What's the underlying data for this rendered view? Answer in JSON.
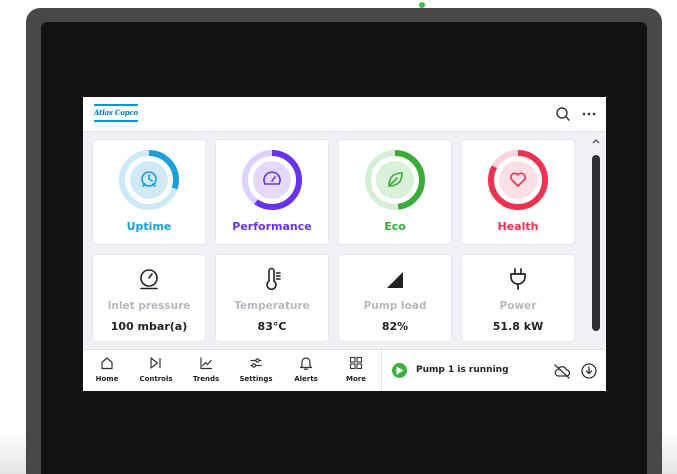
{
  "brand": {
    "logo_text": "Atlas Copco"
  },
  "colors": {
    "uptime": "#1a9fd8",
    "performance": "#6633ee",
    "eco": "#3aac3a",
    "health": "#ee3352",
    "status_running": "#3bb33b"
  },
  "header": {
    "search_icon": "search-icon",
    "more_icon": "more-horizontal-icon"
  },
  "rings": [
    {
      "label": "Uptime",
      "icon": "clock-icon",
      "fill": 0.3
    },
    {
      "label": "Performance",
      "icon": "gauge-icon",
      "fill": 0.6
    },
    {
      "label": "Eco",
      "icon": "leaf-icon",
      "fill": 0.48
    },
    {
      "label": "Health",
      "icon": "heart-icon",
      "fill": 0.83
    }
  ],
  "metrics": [
    {
      "label": "Inlet pressure",
      "value": "100 mbar(a)",
      "icon": "pressure-gauge-icon"
    },
    {
      "label": "Temperature",
      "value": "83°C",
      "icon": "thermometer-icon"
    },
    {
      "label": "Pump load",
      "value": "82%",
      "icon": "signal-ramp-icon"
    },
    {
      "label": "Power",
      "value": "51.8 kW",
      "icon": "plug-icon"
    }
  ],
  "nav": [
    {
      "label": "Home",
      "icon": "home-icon"
    },
    {
      "label": "Controls",
      "icon": "play-pause-icon"
    },
    {
      "label": "Trends",
      "icon": "line-chart-icon"
    },
    {
      "label": "Settings",
      "icon": "sliders-icon"
    },
    {
      "label": "Alerts",
      "icon": "bell-icon"
    },
    {
      "label": "More",
      "icon": "grid-icon"
    }
  ],
  "status": {
    "text": "Pump 1 is running",
    "icon": "play-icon"
  }
}
